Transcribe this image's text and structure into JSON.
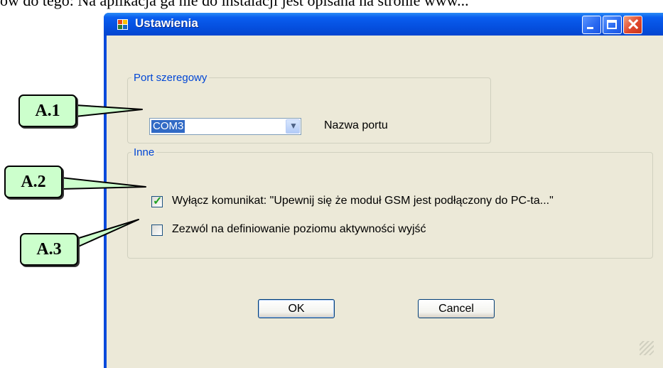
{
  "document": {
    "text": "ow do tego: Na aplikacja ga nie do instalacji jest opisana na stronie www..."
  },
  "window": {
    "title": "Ustawienia",
    "controls": {
      "minimize": "minimize-icon",
      "maximize": "maximize-icon",
      "close": "close-icon"
    }
  },
  "serial_port_group": {
    "legend": "Port szeregowy",
    "port_value": "COM3",
    "port_label": "Nazwa portu"
  },
  "other_group": {
    "legend": "Inne",
    "option1": {
      "label": "Wyłącz komunikat: \"Upewnij się że moduł GSM jest podłączony do PC-ta...\"",
      "checked": true
    },
    "option2": {
      "label": "Zezwól na definiowanie poziomu aktywności wyjść",
      "checked": false
    }
  },
  "buttons": {
    "ok": "OK",
    "cancel": "Cancel"
  },
  "callouts": [
    "A.1",
    "A.2",
    "A.3"
  ],
  "colors": {
    "callout_fill": "#CCFFCC",
    "titlebar": "#0A5EEF",
    "legend": "#0046D5",
    "dialog": "#ECE9D8"
  }
}
